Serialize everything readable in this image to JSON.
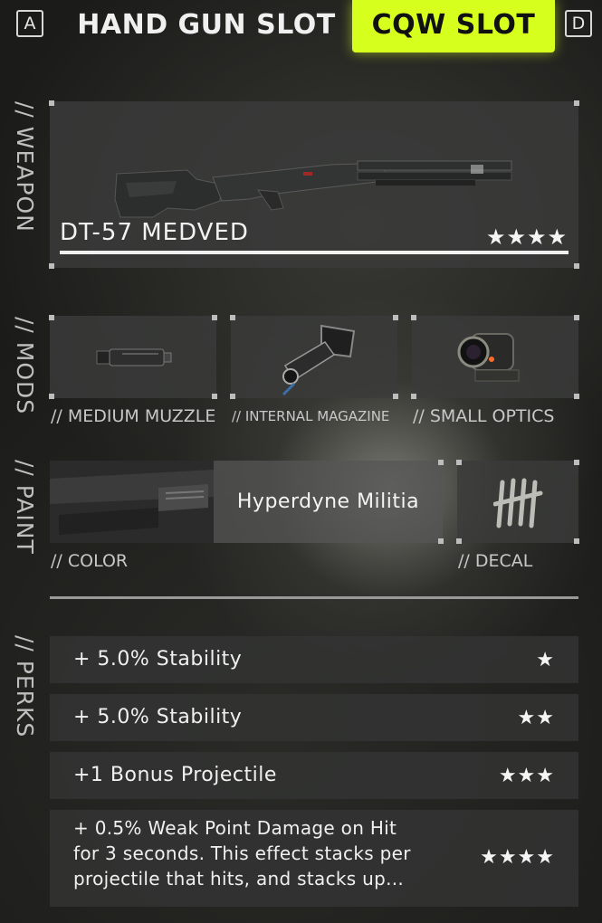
{
  "header": {
    "left_key": "A",
    "right_key": "D",
    "tabs": [
      {
        "label": "HAND GUN SLOT",
        "active": false
      },
      {
        "label": "CQW SLOT",
        "active": true
      }
    ],
    "accent_color": "#d7ff1e"
  },
  "sections": {
    "weapon": "// WEAPON",
    "mods": "// MODS",
    "paint": "// PAINT",
    "perks": "// PERKS"
  },
  "weapon": {
    "name": "DT-57 MEDVED",
    "rating": "★★★★",
    "image_icon": "shotgun-image"
  },
  "mods": [
    {
      "label": "// MEDIUM MUZZLE",
      "icon": "muzzle-image"
    },
    {
      "label": "// INTERNAL MAGAZINE",
      "icon": "magazine-image"
    },
    {
      "label": "// SMALL OPTICS",
      "icon": "optics-image"
    }
  ],
  "paint": {
    "color_name": "Hyperdyne Militia",
    "color_caption": "// COLOR",
    "decal_caption": "// DECAL",
    "decal_icon": "tally-marks-decal"
  },
  "perks": [
    {
      "text": "+ 5.0% Stability",
      "stars": "★"
    },
    {
      "text": "+ 5.0% Stability",
      "stars": "★★"
    },
    {
      "text": "+1 Bonus Projectile",
      "stars": "★★★"
    },
    {
      "text": "+ 0.5% Weak Point Damage on Hit for 3 seconds. This effect stacks per projectile that hits, and stacks up...",
      "stars": "★★★★"
    }
  ]
}
